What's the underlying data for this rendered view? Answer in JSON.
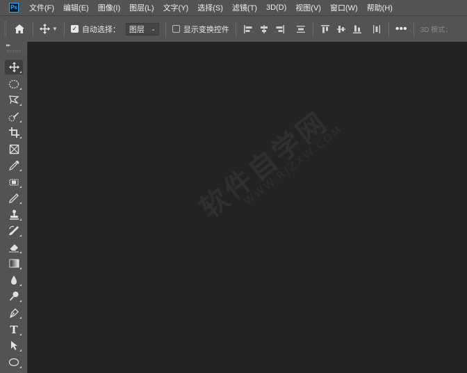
{
  "app": {
    "logo_text": "Ps"
  },
  "menu": [
    "文件(F)",
    "编辑(E)",
    "图像(I)",
    "图层(L)",
    "文字(Y)",
    "选择(S)",
    "滤镜(T)",
    "3D(D)",
    "视图(V)",
    "窗口(W)",
    "帮助(H)"
  ],
  "options": {
    "home_icon": "home-icon",
    "move_icon": "move-icon",
    "auto_select_label": "自动选择：",
    "auto_select_checked": true,
    "auto_select_target": "图层",
    "show_transform_label": "显示变换控件",
    "show_transform_checked": false,
    "more_label": "•••",
    "mode_label": "3D 模式："
  },
  "tools": [
    {
      "name": "move-tool",
      "icon": "move-icon",
      "active": true
    },
    {
      "name": "marquee-tool",
      "icon": "ellipse-marquee-icon"
    },
    {
      "name": "lasso-tool",
      "icon": "polygon-lasso-icon"
    },
    {
      "name": "quick-select-tool",
      "icon": "quick-select-icon"
    },
    {
      "name": "crop-tool",
      "icon": "crop-icon"
    },
    {
      "name": "frame-tool",
      "icon": "frame-icon"
    },
    {
      "name": "eyedropper-tool",
      "icon": "eyedropper-icon"
    },
    {
      "name": "healing-brush-tool",
      "icon": "bandage-icon"
    },
    {
      "name": "brush-tool",
      "icon": "brush-icon"
    },
    {
      "name": "stamp-tool",
      "icon": "stamp-icon"
    },
    {
      "name": "history-brush-tool",
      "icon": "history-brush-icon"
    },
    {
      "name": "eraser-tool",
      "icon": "eraser-icon"
    },
    {
      "name": "gradient-tool",
      "icon": "gradient-icon"
    },
    {
      "name": "blur-tool",
      "icon": "blur-drop-icon"
    },
    {
      "name": "dodge-tool",
      "icon": "dodge-icon"
    },
    {
      "name": "pen-tool",
      "icon": "pen-icon"
    },
    {
      "name": "type-tool",
      "icon": "type-icon",
      "glyph": "T"
    },
    {
      "name": "path-select-tool",
      "icon": "path-select-arrow-icon"
    },
    {
      "name": "shape-tool",
      "icon": "ellipse-shape-icon"
    }
  ],
  "watermark": {
    "cn": "软件自学网",
    "en": "WWW.RJZXW.COM"
  }
}
